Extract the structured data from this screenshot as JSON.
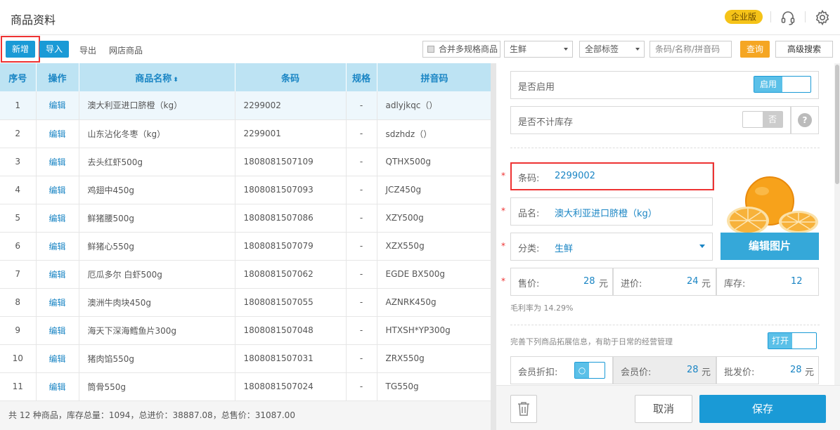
{
  "header": {
    "title": "商品资料",
    "badge": "企业版",
    "icons": [
      "headset-icon",
      "gear-icon"
    ]
  },
  "toolbar": {
    "new_label": "新增",
    "import_label": "导入",
    "export_label": "导出",
    "online_label": "网店商品",
    "merge_label": "合并多规格商品",
    "category_value": "生鲜",
    "tags_value": "全部标签",
    "search_placeholder": "条码/名称/拼音码",
    "query_label": "查询",
    "advanced_label": "高级搜索"
  },
  "table": {
    "columns": [
      "序号",
      "操作",
      "商品名称",
      "条码",
      "规格",
      "拼音码"
    ],
    "sort_glyph": "⬍",
    "rows": [
      {
        "no": "1",
        "action": "编辑",
        "name": "澳大利亚进口脐橙（kg）",
        "barcode": "2299002",
        "spec": "-",
        "pinyin": "adlyjkqc（）"
      },
      {
        "no": "2",
        "action": "编辑",
        "name": "山东沾化冬枣（kg）",
        "barcode": "2299001",
        "spec": "-",
        "pinyin": "sdzhdz（）"
      },
      {
        "no": "3",
        "action": "编辑",
        "name": "去头红虾500g",
        "barcode": "1808081507109",
        "spec": "-",
        "pinyin": "QTHX500g"
      },
      {
        "no": "4",
        "action": "编辑",
        "name": "鸡翅中450g",
        "barcode": "1808081507093",
        "spec": "-",
        "pinyin": "JCZ450g"
      },
      {
        "no": "5",
        "action": "编辑",
        "name": "鲜猪腰500g",
        "barcode": "1808081507086",
        "spec": "-",
        "pinyin": "XZY500g"
      },
      {
        "no": "6",
        "action": "编辑",
        "name": "鲜猪心550g",
        "barcode": "1808081507079",
        "spec": "-",
        "pinyin": "XZX550g"
      },
      {
        "no": "7",
        "action": "编辑",
        "name": "厄瓜多尔 白虾500g",
        "barcode": "1808081507062",
        "spec": "-",
        "pinyin": "EGDE BX500g"
      },
      {
        "no": "8",
        "action": "编辑",
        "name": "澳洲牛肉块450g",
        "barcode": "1808081507055",
        "spec": "-",
        "pinyin": "AZNRK450g"
      },
      {
        "no": "9",
        "action": "编辑",
        "name": "海天下深海鳕鱼片300g",
        "barcode": "1808081507048",
        "spec": "-",
        "pinyin": "HTXSH*YP300g"
      },
      {
        "no": "10",
        "action": "编辑",
        "name": "猪肉馅550g",
        "barcode": "1808081507031",
        "spec": "-",
        "pinyin": "ZRX550g"
      },
      {
        "no": "11",
        "action": "编辑",
        "name": "筒骨550g",
        "barcode": "1808081507024",
        "spec": "-",
        "pinyin": "TG550g"
      }
    ]
  },
  "footer": {
    "summary": "共 12 种商品，库存总量：1094，总进价：38887.08，总售价：31087.00"
  },
  "panel": {
    "enabled_label": "是否启用",
    "enabled_toggle": "启用",
    "no_stock_label": "是否不计库存",
    "no_stock_toggle": "否",
    "help_glyph": "?",
    "required_mark": "*",
    "barcode_label": "条码:",
    "barcode_value": "2299002",
    "name_label": "品名:",
    "name_value": "澳大利亚进口脐橙（kg）",
    "category_label": "分类:",
    "category_value": "生鲜",
    "edit_image_label": "编辑图片",
    "price_label": "售价:",
    "price_value": "28",
    "cost_label": "进价:",
    "cost_value": "24",
    "stock_label": "库存:",
    "stock_value": "12",
    "unit": "元",
    "margin_text": "毛利率为 14.29%",
    "extend_text": "完善下列商品拓展信息，有助于日常的经营管理",
    "extend_toggle": "打开",
    "member_discount_label": "会员折扣:",
    "member_discount_toggle": "○",
    "member_price_label": "会员价:",
    "member_price_value": "28",
    "wholesale_label": "批发价:",
    "wholesale_value": "28",
    "cancel_label": "取消",
    "save_label": "保存"
  },
  "colors": {
    "accent": "#1a9ad6",
    "header_bg": "#bde3f3",
    "badge": "#f5c318",
    "query": "#f5a623",
    "highlight": "#e33333"
  }
}
